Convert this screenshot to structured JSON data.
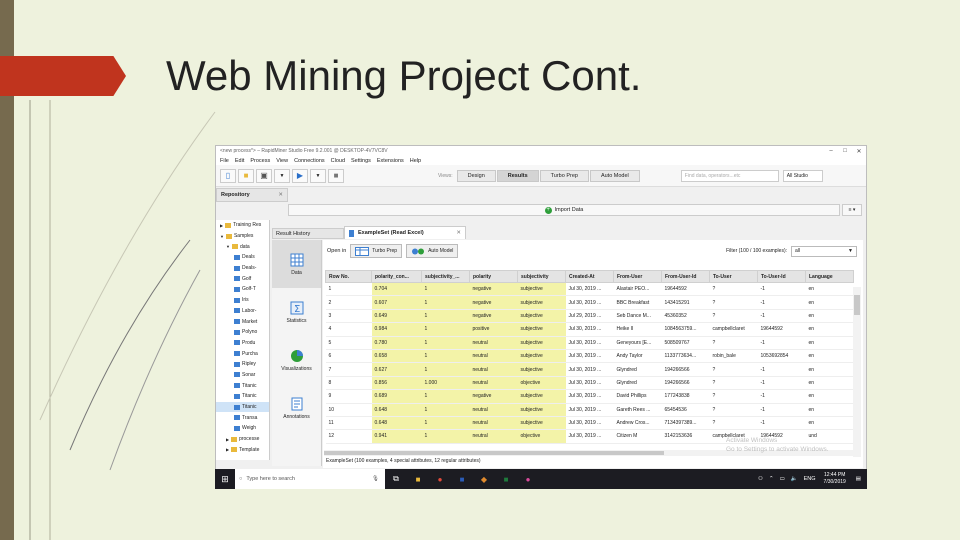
{
  "slide": {
    "title": "Web Mining Project Cont.",
    "colors": {
      "background": "#eef2dd",
      "accent": "#c0341e",
      "side": "#766a4e"
    }
  },
  "window": {
    "title": "<new process*> – RapidMiner Studio Free 9.2.001 @ DESKTOP-4V7VC8V",
    "menu": [
      "File",
      "Edit",
      "Process",
      "View",
      "Connections",
      "Cloud",
      "Settings",
      "Extensions",
      "Help"
    ],
    "views_label": "Views:",
    "views": [
      "Design",
      "Results",
      "Turbo Prep",
      "Auto Model"
    ],
    "active_view": "Results",
    "search_placeholder": "Find data, operators...etc",
    "studio_select": "All Studio"
  },
  "repository": {
    "tab_label": "Repository",
    "import_label": "Import Data",
    "tree": [
      {
        "label": "Training Res",
        "icon": "folder"
      },
      {
        "label": "Samples",
        "icon": "folder"
      },
      {
        "label": "data",
        "icon": "folder"
      },
      {
        "label": "Deals",
        "icon": "data"
      },
      {
        "label": "Deals-",
        "icon": "data"
      },
      {
        "label": "Golf",
        "icon": "data"
      },
      {
        "label": "Golf-T",
        "icon": "data"
      },
      {
        "label": "Iris",
        "icon": "data"
      },
      {
        "label": "Labor-",
        "icon": "data"
      },
      {
        "label": "Market",
        "icon": "data"
      },
      {
        "label": "Polyno",
        "icon": "data"
      },
      {
        "label": "Produ",
        "icon": "data"
      },
      {
        "label": "Purcha",
        "icon": "data"
      },
      {
        "label": "Ripley",
        "icon": "data"
      },
      {
        "label": "Sonar",
        "icon": "data"
      },
      {
        "label": "Titanic",
        "icon": "data"
      },
      {
        "label": "Titanic",
        "icon": "data"
      },
      {
        "label": "Titanic",
        "icon": "data"
      },
      {
        "label": "Transa",
        "icon": "data"
      },
      {
        "label": "Weigh",
        "icon": "data"
      },
      {
        "label": "processe",
        "icon": "folder"
      },
      {
        "label": "Template",
        "icon": "folder"
      }
    ]
  },
  "results": {
    "history_tab": "Result History",
    "exampleset_tab": "ExampleSet (Read Excel)",
    "nav": [
      "Data",
      "Statistics",
      "Visualizations",
      "Annotations"
    ],
    "open_in": "Open in",
    "turbo_prep": "Turbo Prep",
    "auto_model": "Auto Model",
    "filter_label": "Filter (100 / 100 examples):",
    "filter_value": "all",
    "columns": [
      "Row No.",
      "polarity_con...",
      "subjectivity_...",
      "polarity",
      "subjectivity",
      "Created-At",
      "From-User",
      "From-User-Id",
      "To-User",
      "To-User-Id",
      "Language"
    ],
    "rows": [
      [
        "1",
        "0.704",
        "1",
        "negative",
        "subjective",
        "Jul 30, 2019 ...",
        "Alastair PEO...",
        "19644592",
        "?",
        "-1",
        "en"
      ],
      [
        "2",
        "0.607",
        "1",
        "negative",
        "subjective",
        "Jul 30, 2019 ...",
        "BBC Breakfast",
        "143415291",
        "?",
        "-1",
        "en"
      ],
      [
        "3",
        "0.649",
        "1",
        "negative",
        "subjective",
        "Jul 29, 2019 ...",
        "Seb Dance M...",
        "45360352",
        "?",
        "-1",
        "en"
      ],
      [
        "4",
        "0.984",
        "1",
        "positive",
        "subjective",
        "Jul 30, 2019 ...",
        "Heike II",
        "1084563759...",
        "campbellclaret",
        "19644592",
        "en"
      ],
      [
        "5",
        "0.780",
        "1",
        "neutral",
        "subjective",
        "Jul 30, 2019 ...",
        "Geneyours [E...",
        "508509767",
        "?",
        "-1",
        "en"
      ],
      [
        "6",
        "0.658",
        "1",
        "neutral",
        "subjective",
        "Jul 30, 2019 ...",
        "Andy Taylor",
        "1133773634...",
        "robin_bale",
        "1053692854",
        "en"
      ],
      [
        "7",
        "0.627",
        "1",
        "neutral",
        "subjective",
        "Jul 30, 2019 ...",
        "Glyndred",
        "194266566",
        "?",
        "-1",
        "en"
      ],
      [
        "8",
        "0.856",
        "1.000",
        "neutral",
        "objective",
        "Jul 30, 2019 ...",
        "Glyndred",
        "194266566",
        "?",
        "-1",
        "en"
      ],
      [
        "9",
        "0.689",
        "1",
        "negative",
        "subjective",
        "Jul 30, 2019 ...",
        "David Phillips",
        "177243838",
        "?",
        "-1",
        "en"
      ],
      [
        "10",
        "0.648",
        "1",
        "neutral",
        "subjective",
        "Jul 30, 2019 ...",
        "Gareth Rees ...",
        "65454536",
        "?",
        "-1",
        "en"
      ],
      [
        "11",
        "0.648",
        "1",
        "neutral",
        "subjective",
        "Jul 30, 2019 ...",
        "Andrew Cros...",
        "7134397389...",
        "?",
        "-1",
        "en"
      ],
      [
        "12",
        "0.941",
        "1",
        "neutral",
        "objective",
        "Jul 30, 2019 ...",
        "Citizen M",
        "3142153636",
        "campbellclaret",
        "19644592",
        "und"
      ]
    ],
    "status": "ExampleSet (100 examples, 4 special attributes, 12 regular attributes)",
    "watermark_1": "Activate Windows",
    "watermark_2": "Go to Settings to activate Windows."
  },
  "taskbar": {
    "search_placeholder": "Type here to search",
    "lang": "ENG",
    "time": "12:44 PM",
    "date": "7/30/2019"
  }
}
